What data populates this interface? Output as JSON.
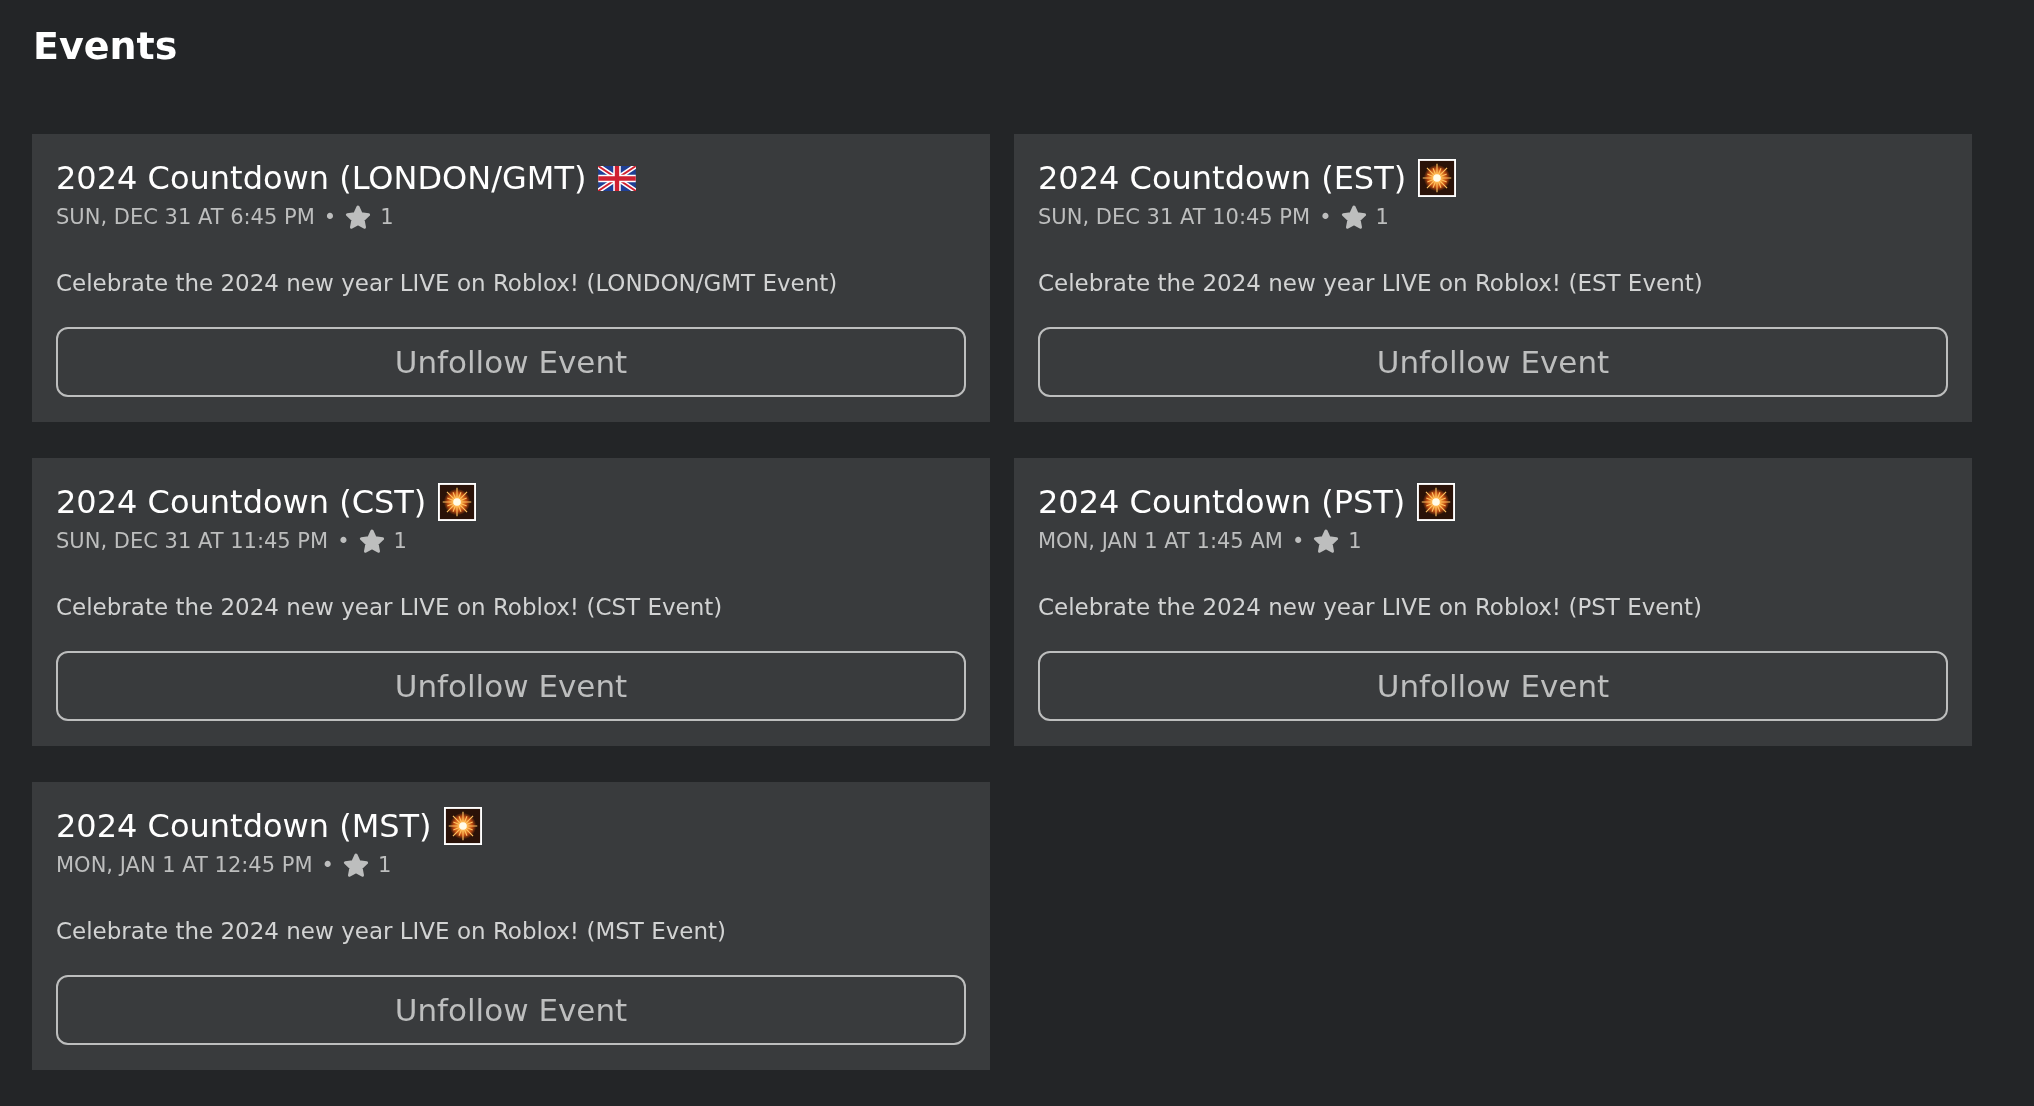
{
  "page": {
    "title": "Events"
  },
  "events": [
    {
      "title": "2024 Countdown (LONDON/GMT)",
      "kind": "flag",
      "date": "SUN, DEC 31 AT 6:45 PM",
      "separator": "•",
      "star_count": "1",
      "description": "Celebrate the 2024 new year LIVE on Roblox! (LONDON/GMT Event)",
      "button": "Unfollow Event"
    },
    {
      "title": "2024 Countdown (EST)",
      "kind": "firework",
      "date": "SUN, DEC 31 AT 10:45 PM",
      "separator": "•",
      "star_count": "1",
      "description": "Celebrate the 2024 new year LIVE on Roblox! (EST Event)",
      "button": "Unfollow Event"
    },
    {
      "title": "2024 Countdown (CST)",
      "kind": "firework",
      "date": "SUN, DEC 31 AT 11:45 PM",
      "separator": "•",
      "star_count": "1",
      "description": "Celebrate the 2024 new year LIVE on Roblox! (CST Event)",
      "button": "Unfollow Event"
    },
    {
      "title": "2024 Countdown (PST)",
      "kind": "firework",
      "date": "MON, JAN 1 AT 1:45 AM",
      "separator": "•",
      "star_count": "1",
      "description": "Celebrate the 2024 new year LIVE on Roblox! (PST Event)",
      "button": "Unfollow Event"
    },
    {
      "title": "2024 Countdown (MST)",
      "kind": "firework",
      "date": "MON, JAN 1 AT 12:45 PM",
      "separator": "•",
      "star_count": "1",
      "description": "Celebrate the 2024 new year LIVE on Roblox! (MST Event)",
      "button": "Unfollow Event"
    }
  ]
}
